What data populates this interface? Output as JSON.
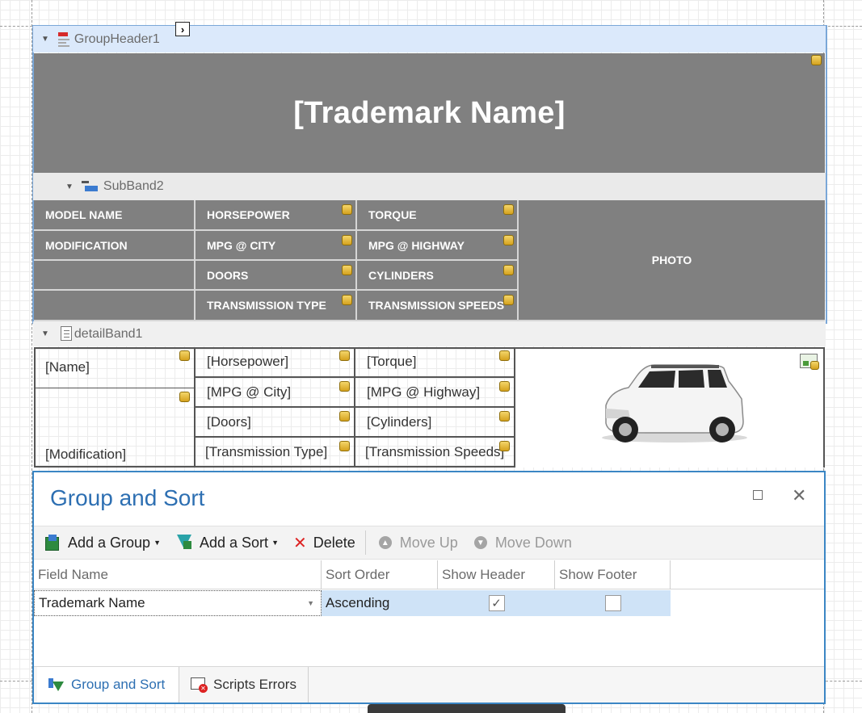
{
  "report": {
    "group_header_label": "GroupHeader1",
    "subband_label": "SubBand2",
    "detail_band_label": "detailBand1",
    "title": "[Trademark Name]",
    "header_cells": {
      "model_name": "MODEL NAME",
      "horsepower": "HORSEPOWER",
      "torque": "TORQUE",
      "modification": "MODIFICATION",
      "mpg_city": "MPG @ CITY",
      "mpg_highway": "MPG @ HIGHWAY",
      "doors": "DOORS",
      "cylinders": "CYLINDERS",
      "transmission_type": "TRANSMISSION TYPE",
      "transmission_speeds": "TRANSMISSION SPEEDS",
      "photo": "PHOTO"
    },
    "detail_cells": {
      "name": "[Name]",
      "modification": "[Modification]",
      "horsepower": "[Horsepower]",
      "torque": "[Torque]",
      "mpg_city": "[MPG @ City]",
      "mpg_highway": "[MPG @ Highway]",
      "doors": "[Doors]",
      "cylinders": "[Cylinders]",
      "transmission_type": "[Transmission Type]",
      "transmission_speeds": "[Transmission Speeds]"
    }
  },
  "panel": {
    "title": "Group and Sort",
    "toolbar": {
      "add_group": "Add a Group",
      "add_sort": "Add a Sort",
      "delete": "Delete",
      "move_up": "Move Up",
      "move_down": "Move Down"
    },
    "columns": [
      "Field Name",
      "Sort Order",
      "Show Header",
      "Show Footer"
    ],
    "rows": [
      {
        "field_name": "Trademark Name",
        "sort_order": "Ascending",
        "show_header": true,
        "show_footer": false
      }
    ],
    "tabs": [
      "Group and Sort",
      "Scripts Errors"
    ],
    "active_tab": "Group and Sort"
  },
  "colors": {
    "accent": "#2d6fb2",
    "band_gray": "#808080",
    "selection": "#cfe3f7"
  }
}
